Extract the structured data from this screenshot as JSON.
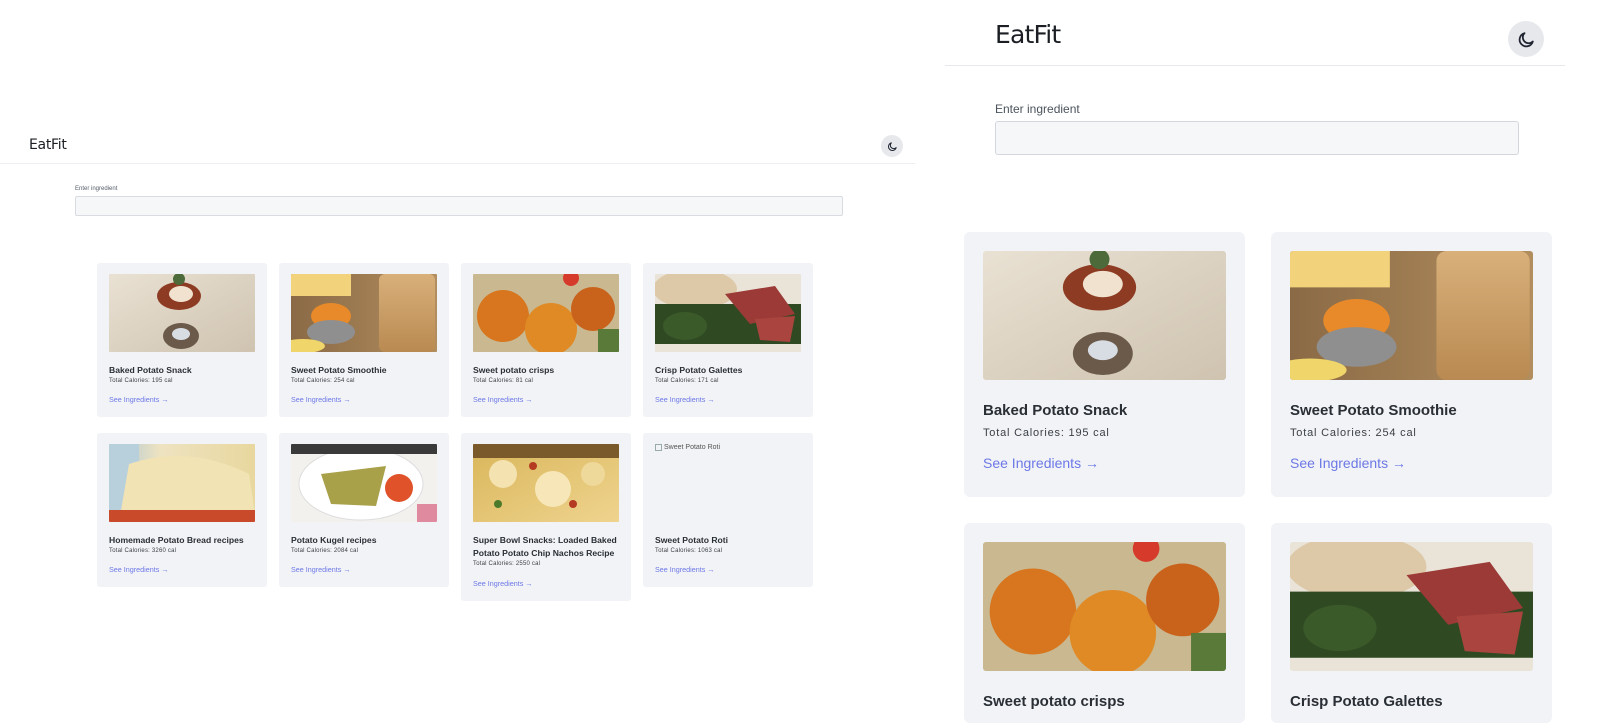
{
  "app": {
    "name": "EatFit"
  },
  "theme_toggle": {
    "icon": "moon-icon"
  },
  "search": {
    "label": "Enter ingredient",
    "value": "",
    "placeholder": ""
  },
  "link_label": "See Ingredients",
  "recipes": [
    {
      "title": "Baked Potato Snack",
      "calories": "Total Calories: 195 cal",
      "image": "baked-potato-photo"
    },
    {
      "title": "Sweet Potato Smoothie",
      "calories": "Total Calories: 254 cal",
      "image": "smoothie-photo"
    },
    {
      "title": "Sweet potato crisps",
      "calories": "Total Calories: 81 cal",
      "image": "crisps-photo"
    },
    {
      "title": "Crisp Potato Galettes",
      "calories": "Total Calories: 171 cal",
      "image": "galettes-photo"
    },
    {
      "title": "Homemade Potato Bread recipes",
      "calories": "Total Calories: 3260 cal",
      "image": "bread-photo"
    },
    {
      "title": "Potato Kugel recipes",
      "calories": "Total Calories: 2084 cal",
      "image": "kugel-photo"
    },
    {
      "title": "Super Bowl Snacks: Loaded Baked Potato Potato Chip Nachos Recipe",
      "calories": "Total Calories: 2550 cal",
      "image": "nachos-photo"
    },
    {
      "title": "Sweet Potato Roti",
      "calories": "Total Calories: 1063 cal",
      "image_alt": "Sweet Potato Roti"
    }
  ]
}
